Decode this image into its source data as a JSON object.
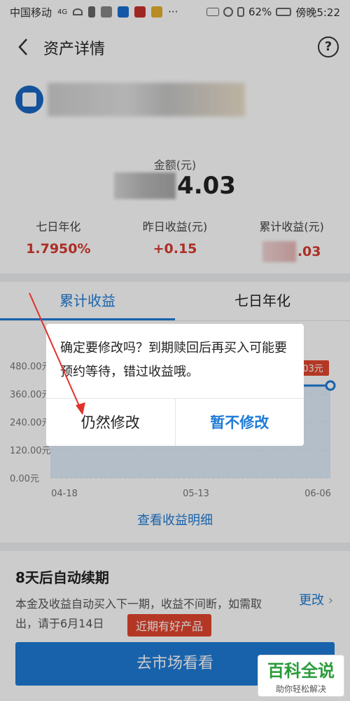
{
  "status_bar": {
    "carrier": "中国移动",
    "network": "4G",
    "battery": "62%",
    "time": "傍晚5:22"
  },
  "nav": {
    "title": "资产详情",
    "help_glyph": "?"
  },
  "asset": {
    "amount_label": "金额(元)",
    "amount_visible": "4.03",
    "stats": [
      {
        "label": "七日年化",
        "value": "1.7950%"
      },
      {
        "label": "昨日收益(元)",
        "value": "+0.15"
      },
      {
        "label": "累计收益(元)",
        "value": ".03"
      }
    ]
  },
  "chart_section": {
    "tabs": [
      "累计收益",
      "七日年化"
    ],
    "active_tab": 0,
    "detail_link": "查看收益明细",
    "tooltip": "03元"
  },
  "chart_data": {
    "type": "area",
    "y_ticks": [
      "480.00元",
      "360.00元",
      "240.00元",
      "120.00元",
      "0.00元"
    ],
    "x_ticks": [
      "04-18",
      "05-13",
      "06-06"
    ],
    "ylim": [
      0,
      480
    ]
  },
  "renew": {
    "title": "8天后自动续期",
    "desc": "本金及收益自动买入下一期，收益不间断，如需取出，请于6月14日",
    "change_label": "更改",
    "badge": "近期有好产品",
    "market_button": "去市场看看"
  },
  "dialog": {
    "message": "确定要修改吗？到期赎回后再买入可能要预约等待，错过收益哦。",
    "confirm_label": "仍然修改",
    "cancel_label": "暂不修改"
  },
  "watermark": {
    "main": "百科全说",
    "sub": "助你轻松解决"
  },
  "colors": {
    "accent": "#1f7bd6",
    "red": "#d63a2f"
  }
}
